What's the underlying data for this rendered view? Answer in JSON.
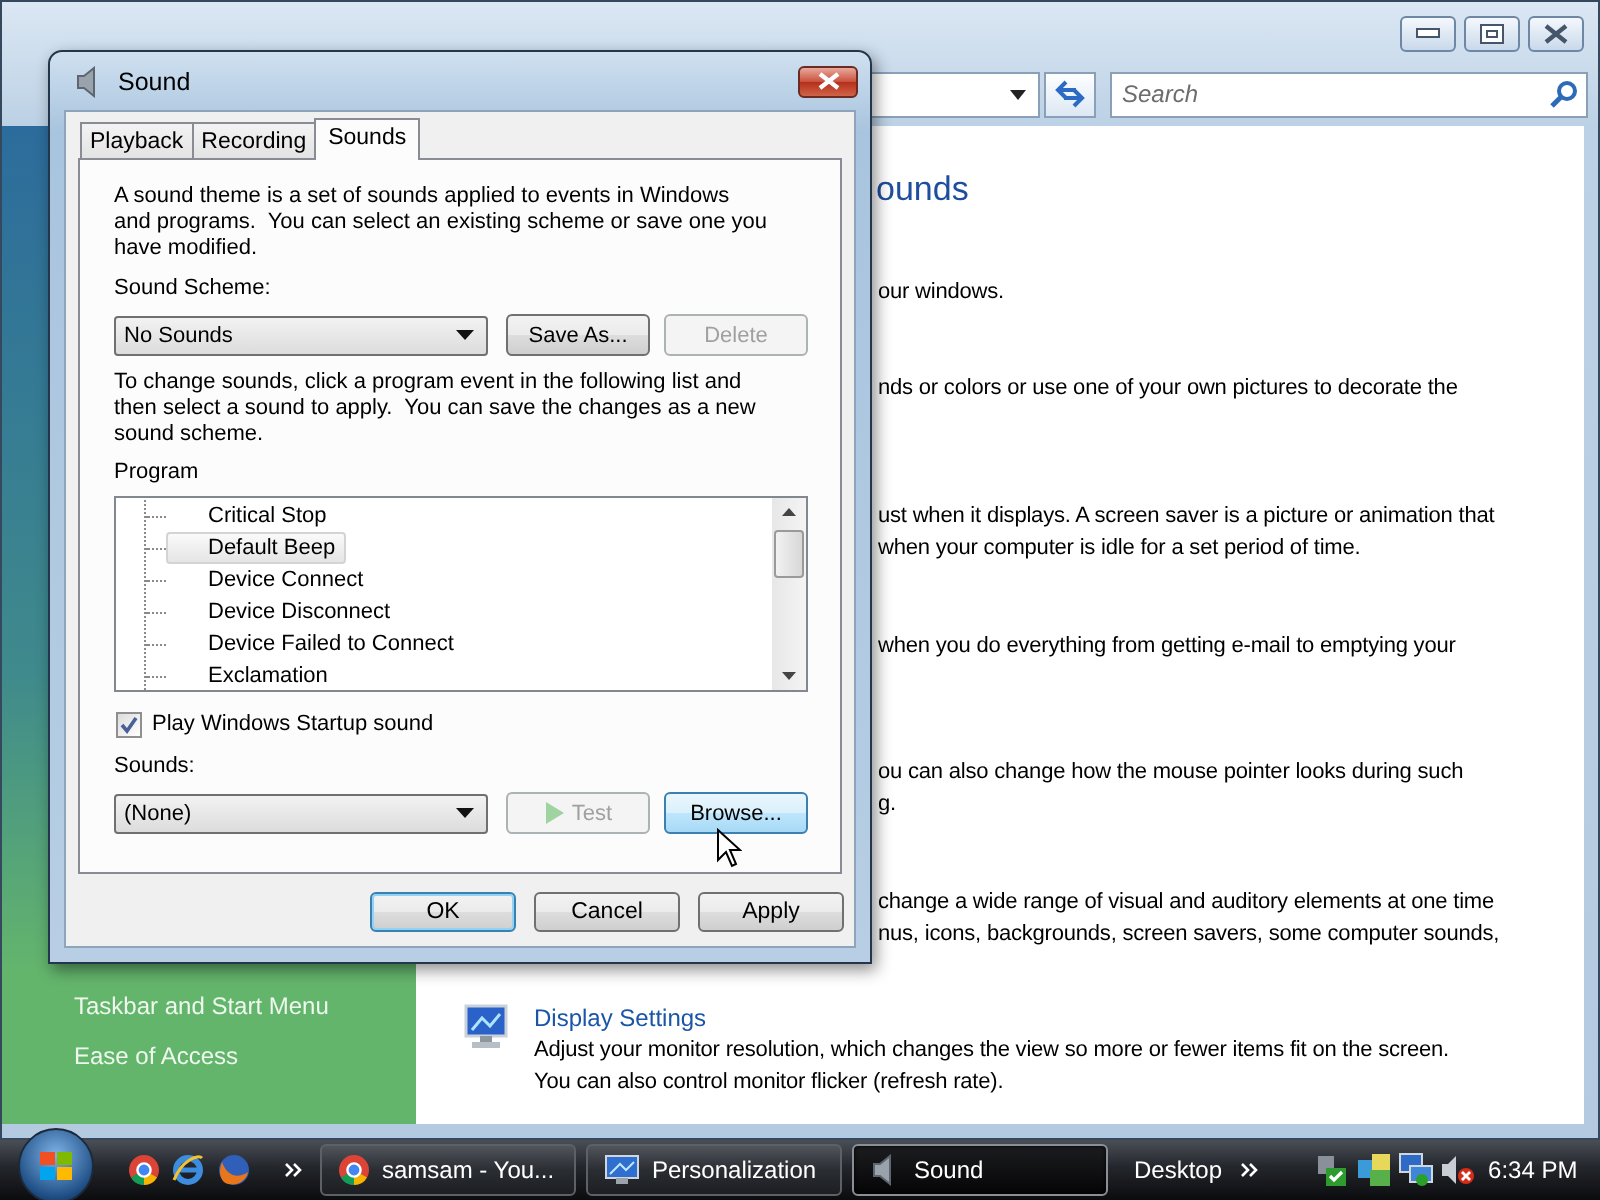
{
  "explorer_window": {
    "search": {
      "placeholder": "Search"
    },
    "sidebar": {
      "items": [
        {
          "label": "Taskbar and Start Menu"
        },
        {
          "label": "Ease of Access"
        }
      ]
    },
    "heading": "ounds",
    "text_blocks": [
      {
        "lines": [
          "our windows."
        ]
      },
      {
        "lines": [
          "nds or colors or use one of your own pictures to decorate the"
        ]
      },
      {
        "lines": [
          "ust when it displays. A screen saver is a picture or animation that",
          "when your computer is idle for a set period of time."
        ]
      },
      {
        "lines": [
          "when you do everything from getting e-mail to emptying your"
        ]
      },
      {
        "lines": [
          "ou can also change how the mouse pointer looks during such",
          "g."
        ]
      },
      {
        "lines": [
          "change a wide range of visual and auditory elements at one time",
          "nus, icons, backgrounds, screen savers, some computer sounds,"
        ]
      }
    ],
    "display_settings": {
      "title": "Display Settings",
      "lines": [
        "Adjust your monitor resolution, which changes the view so more or fewer items fit on the screen.",
        "You can also control monitor flicker (refresh rate)."
      ]
    }
  },
  "dialog": {
    "title": "Sound",
    "tabs": [
      {
        "label": "Playback",
        "selected": false
      },
      {
        "label": "Recording",
        "selected": false
      },
      {
        "label": "Sounds",
        "selected": true
      }
    ],
    "description": [
      "A sound theme is a set of sounds applied to events in Windows",
      "and programs.  You can select an existing scheme or save one you",
      "have modified."
    ],
    "scheme_label": "Sound Scheme:",
    "scheme": {
      "value": "No Sounds"
    },
    "scheme_buttons": [
      {
        "label": "Save As...",
        "disabled": false,
        "hovered": false
      },
      {
        "label": "Delete",
        "disabled": true,
        "hovered": false
      }
    ],
    "instructions": [
      "To change sounds, click a program event in the following list and",
      "then select a sound to apply.  You can save the changes as a new",
      "sound scheme."
    ],
    "program_label": "Program",
    "program_events": [
      {
        "label": "Critical Stop",
        "selected": false
      },
      {
        "label": "Default Beep",
        "selected": true
      },
      {
        "label": "Device Connect",
        "selected": false
      },
      {
        "label": "Device Disconnect",
        "selected": false
      },
      {
        "label": "Device Failed to Connect",
        "selected": false
      },
      {
        "label": "Exclamation",
        "selected": false
      }
    ],
    "startup_sound": {
      "label": "Play Windows Startup sound",
      "checked": true
    },
    "sounds_label": "Sounds:",
    "sound": {
      "value": "(None)"
    },
    "sound_buttons": [
      {
        "kind": "test",
        "label": "Test",
        "disabled": true,
        "hovered": false
      },
      {
        "kind": "plain",
        "label": "Browse...",
        "disabled": false,
        "hovered": true
      }
    ],
    "footer_buttons": [
      {
        "label": "OK",
        "default": true
      },
      {
        "label": "Cancel",
        "default": false
      },
      {
        "label": "Apply",
        "default": false
      }
    ]
  },
  "taskbar": {
    "tasks": [
      {
        "kind": "browser",
        "label": "samsam - You...",
        "selected": false
      },
      {
        "kind": "display",
        "label": "Personalization",
        "selected": false
      },
      {
        "kind": "sound",
        "label": "Sound",
        "selected": true
      }
    ],
    "toolbar_label": "Desktop",
    "clock": "6:34 PM"
  }
}
